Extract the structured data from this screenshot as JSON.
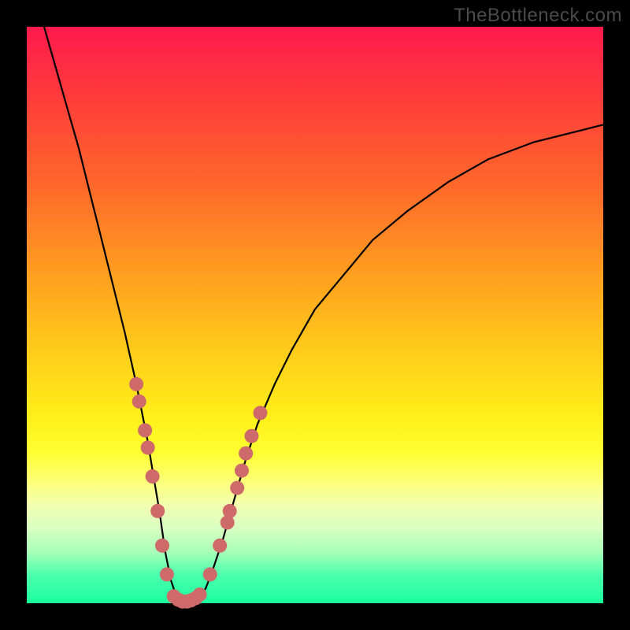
{
  "watermark": "TheBottleneck.com",
  "colors": {
    "curve_stroke": "#000000",
    "marker_fill": "#cf6a6a",
    "marker_stroke": "#b84f4f"
  },
  "chart_data": {
    "type": "line",
    "title": "",
    "xlabel": "",
    "ylabel": "",
    "xlim": [
      0,
      100
    ],
    "ylim": [
      0,
      100
    ],
    "curve": {
      "x": [
        3,
        5,
        7,
        9,
        11,
        13,
        15,
        17,
        19,
        21,
        22,
        23,
        24,
        25,
        26,
        27,
        28,
        29,
        30,
        31,
        32,
        34,
        36,
        38,
        40,
        43,
        46,
        50,
        55,
        60,
        66,
        73,
        80,
        88,
        96,
        100
      ],
      "y": [
        100,
        93,
        86,
        79,
        71,
        63,
        55,
        47,
        38,
        28,
        22,
        16,
        9,
        4,
        1,
        0.3,
        0.3,
        0.6,
        1.2,
        2.5,
        5,
        11,
        18,
        25,
        31,
        38,
        44,
        51,
        57,
        63,
        68,
        73,
        77,
        80,
        82,
        83
      ]
    },
    "markers_left": [
      {
        "x": 19.0,
        "y": 38
      },
      {
        "x": 19.5,
        "y": 35
      },
      {
        "x": 20.5,
        "y": 30
      },
      {
        "x": 21.0,
        "y": 27
      },
      {
        "x": 21.8,
        "y": 22
      },
      {
        "x": 22.7,
        "y": 16
      },
      {
        "x": 23.5,
        "y": 10
      },
      {
        "x": 24.3,
        "y": 5
      }
    ],
    "markers_bottom": [
      {
        "x": 25.5,
        "y": 1.2
      },
      {
        "x": 26.3,
        "y": 0.6
      },
      {
        "x": 27.0,
        "y": 0.3
      },
      {
        "x": 27.8,
        "y": 0.3
      },
      {
        "x": 28.5,
        "y": 0.5
      },
      {
        "x": 29.3,
        "y": 0.9
      },
      {
        "x": 30.0,
        "y": 1.5
      }
    ],
    "markers_right": [
      {
        "x": 31.8,
        "y": 5
      },
      {
        "x": 33.5,
        "y": 10
      },
      {
        "x": 34.8,
        "y": 14
      },
      {
        "x": 35.2,
        "y": 16
      },
      {
        "x": 36.5,
        "y": 20
      },
      {
        "x": 37.3,
        "y": 23
      },
      {
        "x": 38.0,
        "y": 26
      },
      {
        "x": 39.0,
        "y": 29
      },
      {
        "x": 40.5,
        "y": 33
      }
    ]
  }
}
